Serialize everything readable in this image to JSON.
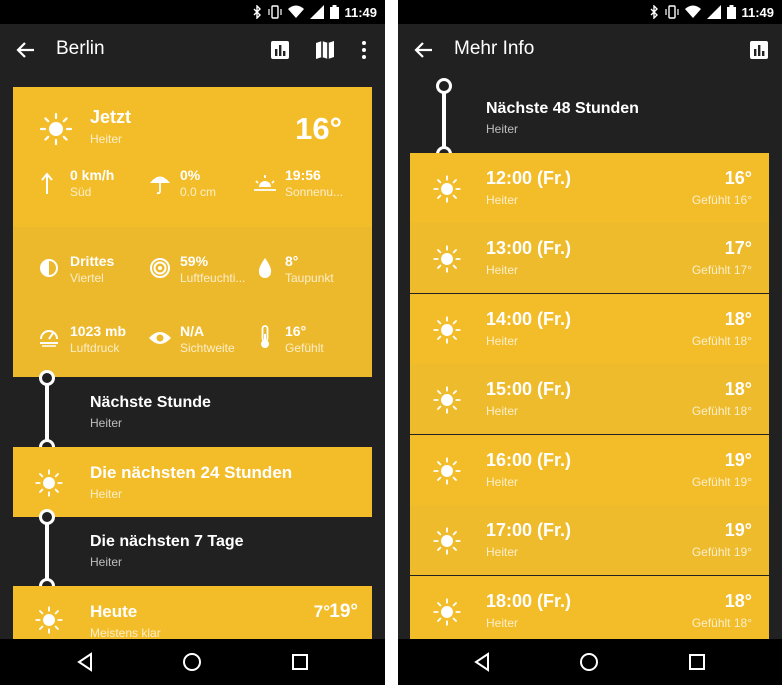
{
  "status": {
    "time": "11:49"
  },
  "left": {
    "title": "Berlin",
    "now": {
      "label": "Jetzt",
      "condition": "Heiter",
      "temp": "16°",
      "wind_value": "0 km/h",
      "wind_dir": "Süd",
      "rain_value": "0%",
      "rain_amount": "0.0 cm",
      "sunset_time": "19:56",
      "sunset_label": "Sonnenu...",
      "moon_value": "Drittes",
      "moon_label": "Viertel",
      "humidity_value": "59%",
      "humidity_label": "Luftfeuchti...",
      "dew_value": "8°",
      "dew_label": "Taupunkt",
      "pressure_value": "1023 mb",
      "pressure_label": "Luftdruck",
      "visibility_value": "N/A",
      "visibility_label": "Sichtweite",
      "feels_value": "16°",
      "feels_label": "Gefühlt"
    },
    "next_hour": {
      "title": "Nächste Stunde",
      "sub": "Heiter"
    },
    "next_24": {
      "title": "Die nächsten 24 Stunden",
      "sub": "Heiter"
    },
    "next_7": {
      "title": "Die nächsten 7 Tage",
      "sub": "Heiter"
    },
    "today": {
      "title": "Heute",
      "sub": "Meistens klar",
      "low": "7°",
      "high": "19°"
    }
  },
  "right": {
    "title": "Mehr Info",
    "section": {
      "title": "Nächste 48 Stunden",
      "sub": "Heiter"
    },
    "hours": [
      {
        "time": "12:00 (Fr.)",
        "desc": "Heiter",
        "temp": "16°",
        "feel": "Gefühlt 16°"
      },
      {
        "time": "13:00 (Fr.)",
        "desc": "Heiter",
        "temp": "17°",
        "feel": "Gefühlt 17°"
      },
      {
        "time": "14:00 (Fr.)",
        "desc": "Heiter",
        "temp": "18°",
        "feel": "Gefühlt 18°"
      },
      {
        "time": "15:00 (Fr.)",
        "desc": "Heiter",
        "temp": "18°",
        "feel": "Gefühlt 18°"
      },
      {
        "time": "16:00 (Fr.)",
        "desc": "Heiter",
        "temp": "19°",
        "feel": "Gefühlt 19°"
      },
      {
        "time": "17:00 (Fr.)",
        "desc": "Heiter",
        "temp": "19°",
        "feel": "Gefühlt 19°"
      },
      {
        "time": "18:00 (Fr.)",
        "desc": "Heiter",
        "temp": "18°",
        "feel": "Gefühlt 18°"
      }
    ]
  },
  "icons": {
    "sun": "sun-icon",
    "back": "back-arrow-icon",
    "chart": "bar-chart-icon",
    "map": "map-icon",
    "more": "more-vert-icon",
    "wind": "wind-arrow-icon",
    "umbrella": "umbrella-icon",
    "sunset": "sunset-icon",
    "moon": "moon-phase-icon",
    "humidity": "humidity-icon",
    "drop": "dew-drop-icon",
    "pressure": "pressure-icon",
    "eye": "visibility-icon",
    "thermometer": "thermometer-icon"
  },
  "colors": {
    "accent": "#f3bd2a",
    "background": "#212121",
    "bars": "#000000"
  }
}
